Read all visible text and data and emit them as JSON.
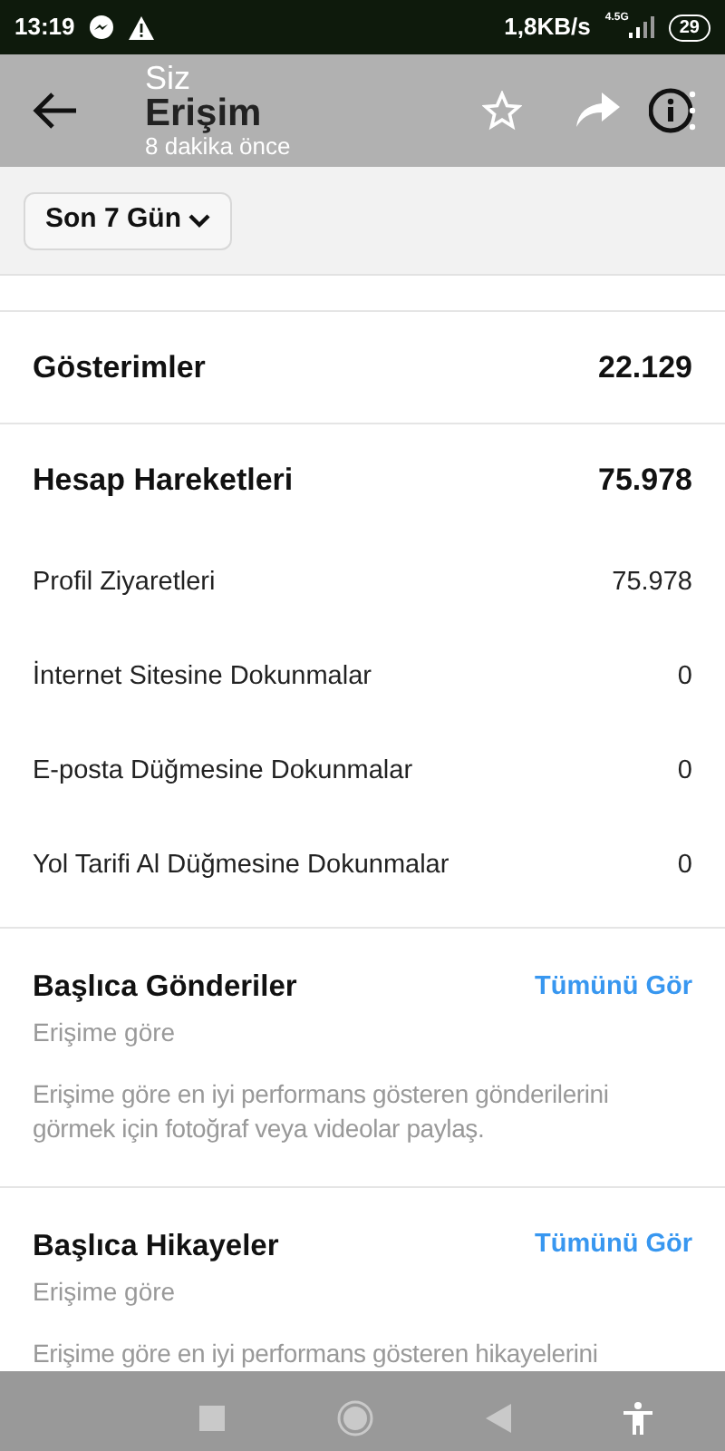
{
  "status_bar": {
    "time": "13:19",
    "speed": "1,8KB/s",
    "network": "4.5G",
    "battery": "29"
  },
  "header": {
    "title": "Erişim",
    "overlay_title": "Siz",
    "overlay_subtitle": "8 dakika önce"
  },
  "filter": {
    "label": "Son 7 Gün"
  },
  "metrics": [
    {
      "label": "Gösterimler",
      "value": "22.129",
      "kind": "main"
    },
    {
      "label": "Hesap Hareketleri",
      "value": "75.978",
      "kind": "main"
    },
    {
      "label": "Profil Ziyaretleri",
      "value": "75.978",
      "kind": "sub"
    },
    {
      "label": "İnternet Sitesine Dokunmalar",
      "value": "0",
      "kind": "sub"
    },
    {
      "label": "E-posta Düğmesine Dokunmalar",
      "value": "0",
      "kind": "sub"
    },
    {
      "label": "Yol Tarifi Al Düğmesine Dokunmalar",
      "value": "0",
      "kind": "sub"
    }
  ],
  "sections": [
    {
      "title": "Başlıca Gönderiler",
      "link": "Tümünü Gör",
      "subtitle": "Erişime göre",
      "body": "Erişime göre en iyi performans gösteren gönderilerini görmek için fotoğraf veya videolar paylaş."
    },
    {
      "title": "Başlıca Hikayeler",
      "link": "Tümünü Gör",
      "subtitle": "Erişime göre",
      "body": "Erişime göre en iyi performans gösteren hikayelerini"
    }
  ]
}
